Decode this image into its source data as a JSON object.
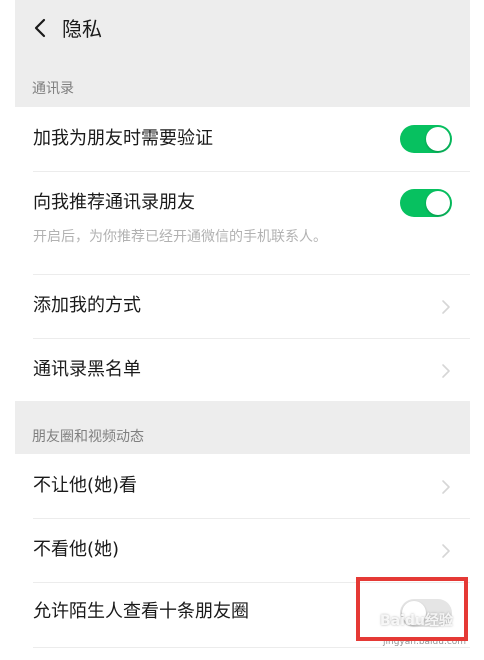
{
  "header": {
    "title": "隐私",
    "back_icon": "chevron-left-icon"
  },
  "sections": {
    "contacts": {
      "header": "通讯录",
      "verify_label": "加我为朋友时需要验证",
      "verify_on": true,
      "recommend_label": "向我推荐通讯录朋友",
      "recommend_on": true,
      "recommend_sub": "开启后，为你推荐已经开通微信的手机联系人。",
      "add_methods_label": "添加我的方式",
      "blacklist_label": "通讯录黑名单"
    },
    "moments": {
      "header": "朋友圈和视频动态",
      "hide_my_posts_label": "不让他(她)看",
      "hide_their_posts_label": "不看他(她)",
      "strangers_view_label": "允许陌生人查看十条朋友圈",
      "strangers_view_on": false
    }
  },
  "colors": {
    "toggle_on": "#07c160",
    "toggle_off": "#e5e5e5",
    "highlight": "#e53935"
  },
  "watermark": {
    "text": "Baidu经验",
    "sub": "jingyan.baidu.com"
  }
}
